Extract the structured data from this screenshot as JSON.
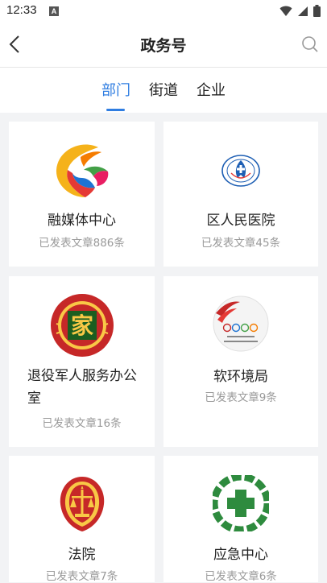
{
  "status_bar": {
    "time": "12:33",
    "notification_badge": "A"
  },
  "header": {
    "title": "政务号"
  },
  "tabs": [
    {
      "label": "部门",
      "active": true
    },
    {
      "label": "街道",
      "active": false
    },
    {
      "label": "企业",
      "active": false
    }
  ],
  "accent_color": "#2f7de1",
  "cards": [
    {
      "name": "融媒体中心",
      "count": "已发表文章886条",
      "logo": "media-center-logo"
    },
    {
      "name": "区人民医院",
      "count": "已发表文章45条",
      "logo": "hospital-logo"
    },
    {
      "name": "退役军人服务办公室",
      "count": "已发表文章16条",
      "logo": "veterans-office-logo",
      "logo_text": "家"
    },
    {
      "name": "软环境局",
      "count": "已发表文章9条",
      "logo": "soft-environment-bureau-logo"
    },
    {
      "name": "法院",
      "count": "已发表文章7条",
      "logo": "court-emblem-logo"
    },
    {
      "name": "应急中心",
      "count": "已发表文章6条",
      "logo": "emergency-center-logo"
    }
  ]
}
